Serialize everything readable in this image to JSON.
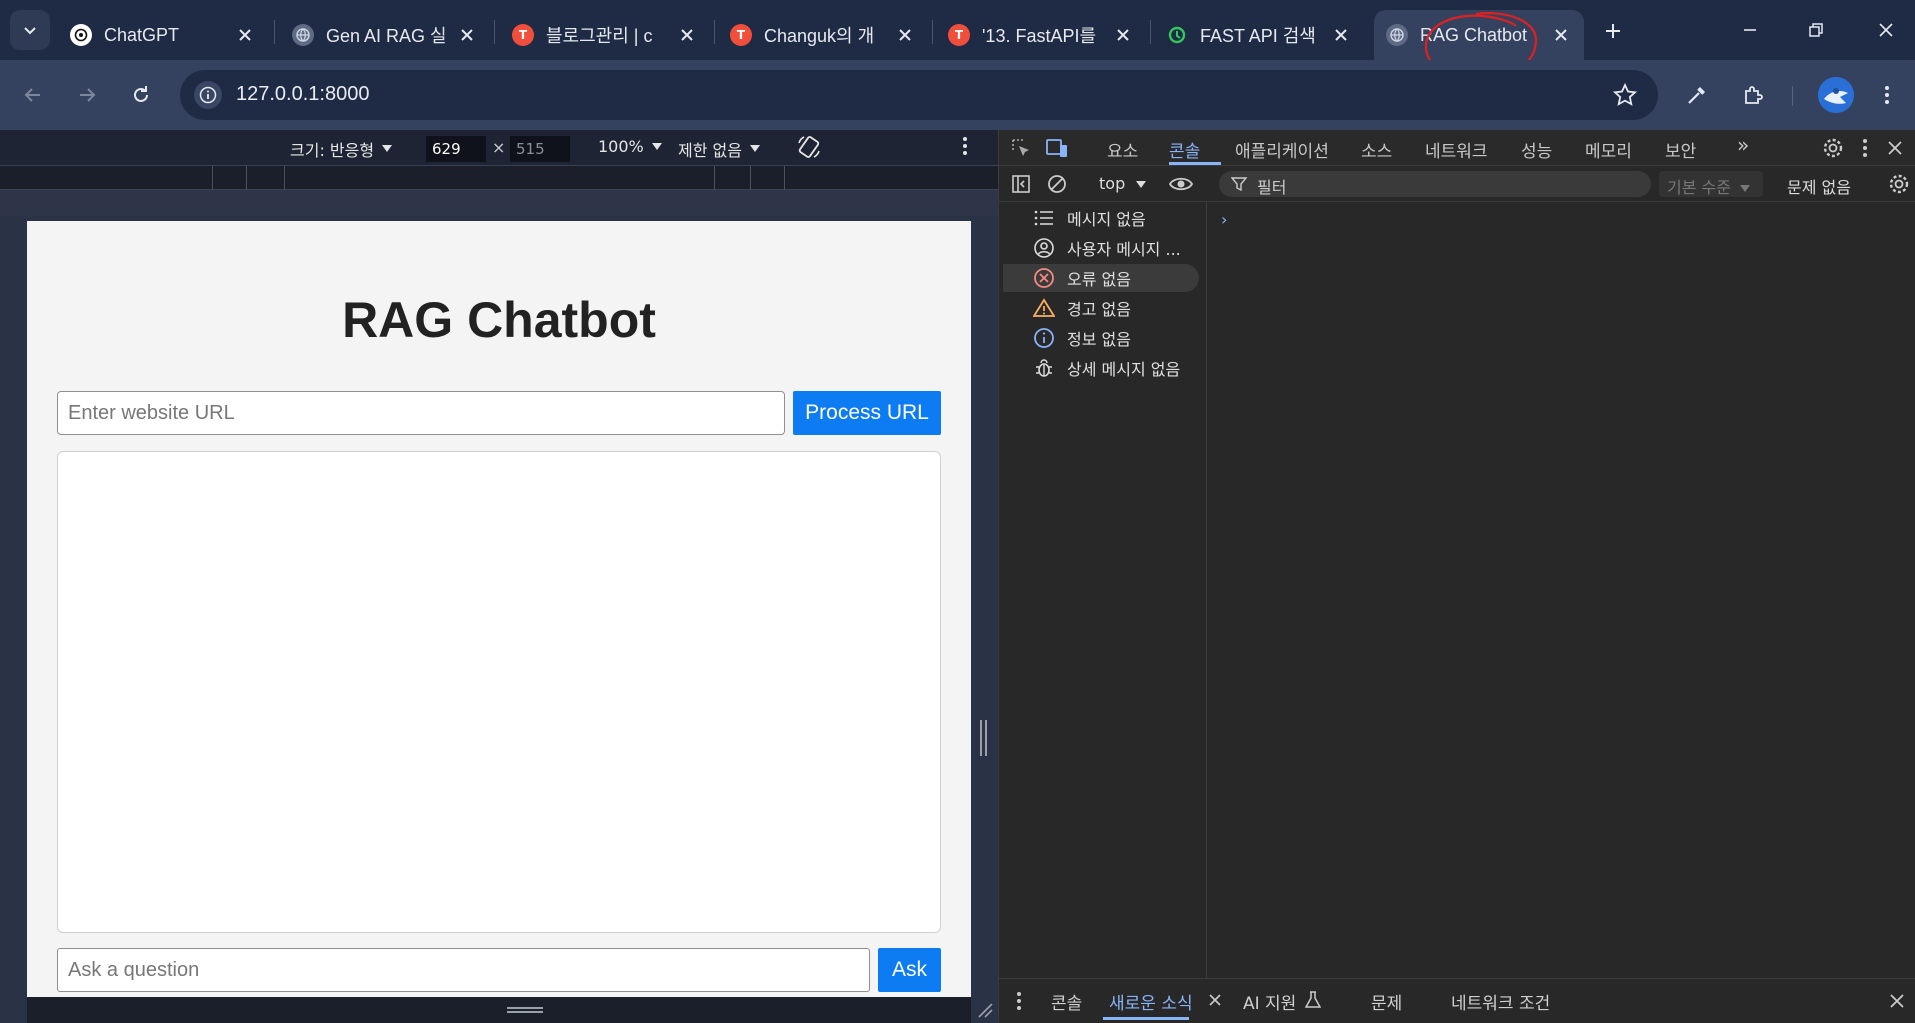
{
  "browser": {
    "tabs": [
      {
        "title": "ChatGPT",
        "favicon": "chatgpt-icon"
      },
      {
        "title": "Gen AI RAG 실",
        "favicon": "globe-icon"
      },
      {
        "title": "블로그관리 | c",
        "favicon": "tistory-icon"
      },
      {
        "title": "Changuk의 개",
        "favicon": "tistory-icon"
      },
      {
        "title": "'13. FastAPI를",
        "favicon": "tistory-icon"
      },
      {
        "title": "FAST API 검색",
        "favicon": "search-engine-icon"
      },
      {
        "title": "RAG Chatbot",
        "favicon": "globe-icon",
        "active": true
      }
    ],
    "address": "127.0.0.1:8000",
    "colors": {
      "frame": "#1f2a44",
      "toolbar": "#35425f",
      "annotation": "#e02020"
    }
  },
  "device_toolbar": {
    "dimensions_label": "크기: 반응형",
    "width": "629",
    "height": "515",
    "times": "×",
    "zoom": "100%",
    "throttle": "제한 없음"
  },
  "app": {
    "title": "RAG Chatbot",
    "url_placeholder": "Enter website URL",
    "process_button": "Process URL",
    "question_placeholder": "Ask a question",
    "ask_button": "Ask",
    "accent": "#0d7cf2"
  },
  "devtools": {
    "tabs": [
      "요소",
      "콘솔",
      "애플리케이션",
      "소스",
      "네트워크",
      "성능",
      "메모리",
      "보안"
    ],
    "active_tab": "콘솔",
    "more": "»",
    "context": "top",
    "filter_placeholder": "필터",
    "levels": "기본 수준",
    "issues": "문제 없음",
    "sidebar": [
      {
        "label": "메시지 없음",
        "icon": "list-icon"
      },
      {
        "label": "사용자 메시지 ...",
        "icon": "user-icon"
      },
      {
        "label": "오류 없음",
        "icon": "error-icon"
      },
      {
        "label": "경고 없음",
        "icon": "warning-icon"
      },
      {
        "label": "정보 없음",
        "icon": "info-icon"
      },
      {
        "label": "상세 메시지 없음",
        "icon": "bug-icon"
      }
    ],
    "prompt": "›",
    "drawer_tabs": [
      "콘솔",
      "새로운 소식",
      "AI 지원",
      "문제",
      "네트워크 조건"
    ],
    "active_drawer": "새로운 소식"
  }
}
